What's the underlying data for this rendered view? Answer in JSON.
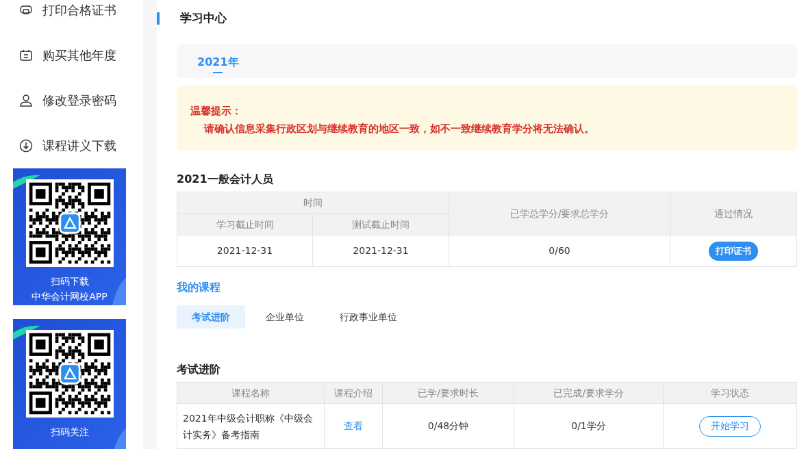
{
  "sidebar": {
    "items": [
      {
        "kind": "printer",
        "label": "打印合格证书"
      },
      {
        "kind": "calendar",
        "label": "购买其他年度"
      },
      {
        "kind": "user",
        "label": "修改登录密码"
      },
      {
        "kind": "download",
        "label": "课程讲义下载"
      }
    ],
    "promo_cards": [
      {
        "caption": [
          "扫码下载",
          "中华会计网校APP"
        ]
      },
      {
        "caption": [
          "扫码关注"
        ]
      }
    ]
  },
  "page_title": "学习中心",
  "year_tabs": [
    {
      "label": "2021年",
      "selected": true
    }
  ],
  "notice": {
    "title": "温馨提示：",
    "body": "请确认信息采集行政区划与继续教育的地区一致，如不一致继续教育学分将无法确认。"
  },
  "summary": {
    "title": "2021一般会计人员",
    "group_header": "时间",
    "columns": [
      "学习截止时间",
      "测试截止时间",
      "已学总学分/要求总学分",
      "通过情况"
    ],
    "rows": [
      {
        "study_deadline": "2021-12-31",
        "test_deadline": "2021-12-31",
        "credits": "0/60",
        "action": "打印证书"
      }
    ]
  },
  "my_courses": {
    "title": "我的课程",
    "tabs": [
      {
        "label": "考试进阶",
        "selected": true
      },
      {
        "label": "企业单位",
        "selected": false
      },
      {
        "label": "行政事业单位",
        "selected": false
      }
    ]
  },
  "course_table": {
    "title": "考试进阶",
    "columns": [
      "课程名称",
      "课程介绍",
      "已学/要求时长",
      "已完成/要求学分",
      "学习状态"
    ],
    "rows": [
      {
        "name": "2021年中级会计职称《中级会计实务》备考指南",
        "intro_link": "查看",
        "duration": "0/48分钟",
        "credits": "0/1学分",
        "action": "开始学习"
      }
    ]
  }
}
